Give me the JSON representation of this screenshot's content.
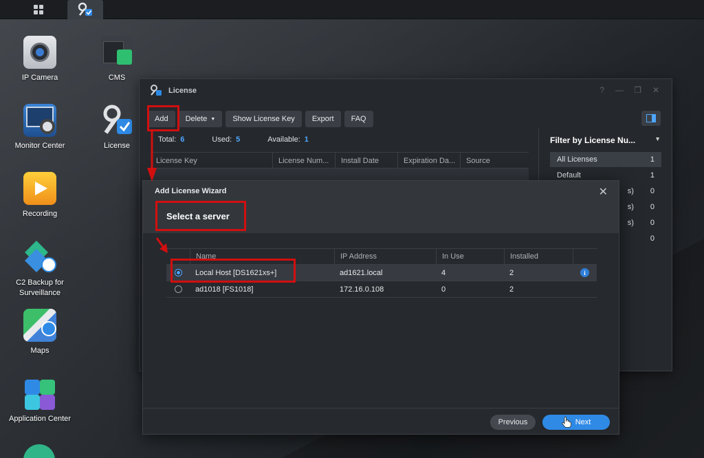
{
  "taskbar": {
    "buttons": [
      {
        "name": "main-menu",
        "icon": "grid-icon"
      },
      {
        "name": "license",
        "icon": "license-key-icon"
      }
    ]
  },
  "desktop": {
    "icons": [
      {
        "label": "IP Camera",
        "icon": "ip-camera-icon"
      },
      {
        "label": "CMS",
        "icon": "cms-icon"
      },
      {
        "label": "Monitor Center",
        "icon": "monitor-center-icon"
      },
      {
        "label": "License",
        "icon": "license-key-icon"
      },
      {
        "label": "Recording",
        "icon": "recording-icon"
      },
      {
        "label": "C2 Backup for\nSurveillance",
        "icon": "c2-backup-icon"
      },
      {
        "label": "Maps",
        "icon": "maps-icon"
      },
      {
        "label": "Application Center",
        "icon": "application-center-icon"
      }
    ]
  },
  "license_window": {
    "title": "License",
    "toolbar": {
      "add": "Add",
      "delete": "Delete",
      "show_key": "Show License Key",
      "export": "Export",
      "faq": "FAQ"
    },
    "totals": {
      "total_label": "Total:",
      "total": "6",
      "used_label": "Used:",
      "used": "5",
      "available_label": "Available:",
      "available": "1"
    },
    "columns": [
      "License Key",
      "License Num...",
      "Install Date",
      "Expiration Da...",
      "Source"
    ],
    "filter": {
      "title": "Filter by License Nu...",
      "items": [
        {
          "label": "All Licenses",
          "count": "1"
        },
        {
          "label": "Default",
          "count": "1"
        },
        {
          "label": "s)",
          "count": "0"
        },
        {
          "label": "s)",
          "count": "0"
        },
        {
          "label": "s)",
          "count": "0"
        },
        {
          "label": "",
          "count": "0"
        }
      ]
    }
  },
  "wizard": {
    "title": "Add License Wizard",
    "step": "Select a server",
    "columns": {
      "name": "Name",
      "ip": "IP Address",
      "in_use": "In Use",
      "installed": "Installed"
    },
    "rows": [
      {
        "name": "Local Host [DS1621xs+]",
        "ip": "ad1621.local",
        "in_use": "4",
        "installed": "2",
        "selected": true
      },
      {
        "name": "ad1018 [FS1018]",
        "ip": "172.16.0.108",
        "in_use": "0",
        "installed": "2",
        "selected": false
      }
    ],
    "previous": "Previous",
    "next": "Next"
  },
  "colors": {
    "accent": "#2f8ae6",
    "highlight_red": "#d10f0f",
    "count_blue": "#4ea6ff"
  }
}
